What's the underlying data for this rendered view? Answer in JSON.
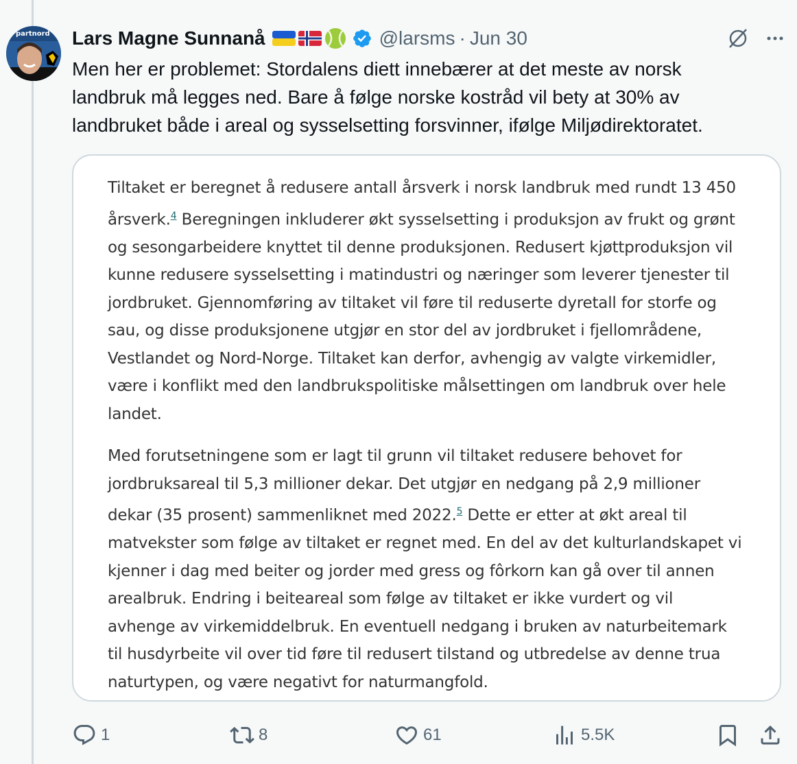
{
  "tweet": {
    "author_name": "Lars Magne Sunnanå",
    "handle": "@larsms",
    "separator": "·",
    "date": "Jun 30",
    "avatar_text": "partnord",
    "text_lines": [
      "Men her er problemet: Stordalens diett innebærer at det meste av norsk",
      "landbruk må legges ned. Bare å følge norske kostråd vil bety at 30% av",
      "landbruket både i areal og sysselsetting forsvinner, ifølge Miljødirektoratet."
    ]
  },
  "image": {
    "paragraph1": {
      "line1": "Tiltaket er beregnet å redusere antall årsverk i norsk landbruk med rundt 13 450",
      "line2_pre": "årsverk.",
      "line2_fn": "4",
      "line2_post": " Beregningen inkluderer økt sysselsetting i produksjon av frukt og grønt",
      "lines": [
        "og sesongarbeidere knyttet til denne produksjonen. Redusert kjøttproduksjon vil",
        "kunne redusere sysselsetting i matindustri og næringer som leverer tjenester til",
        "jordbruket. Gjennomføring av tiltaket vil føre til reduserte dyretall for storfe og",
        "sau, og disse produksjonene utgjør en stor del av jordbruket i fjellområdene,",
        "Vestlandet og Nord-Norge. Tiltaket kan derfor, avhengig av valgte virkemidler,",
        "være i konflikt med den landbrukspolitiske målsettingen om landbruk over hele",
        "landet."
      ]
    },
    "paragraph2": {
      "line1": "Med forutsetningene som er lagt til grunn vil tiltaket redusere behovet for",
      "line2": "jordbruksareal til 5,3 millioner dekar. Det utgjør en nedgang på 2,9 millioner",
      "line3_pre": "dekar (35 prosent) sammenliknet med 2022.",
      "line3_fn": "5",
      "line3_post": "  Dette er etter at økt areal til",
      "lines": [
        "matvekster som følge av tiltaket er regnet med. En del av det kulturlandskapet vi",
        "kjenner i dag med beiter og jorder med gress og fôrkorn kan gå over til annen",
        "arealbruk. Endring i beiteareal som følge av tiltaket er ikke vurdert og vil",
        "avhenge av virkemiddelbruk. En eventuell nedgang i bruken av naturbeitemark",
        "til husdyrbeite vil over tid føre til redusert tilstand og utbredelse av denne trua",
        "naturtypen, og være negativt for naturmangfold."
      ]
    }
  },
  "actions": {
    "replies": "1",
    "reposts": "8",
    "likes": "61",
    "views": "5.5K"
  },
  "icons": {
    "reply": "reply-icon",
    "repost": "repost-icon",
    "like": "heart-icon",
    "views": "views-icon",
    "bookmark": "bookmark-icon",
    "share": "share-icon",
    "grok": "grok-icon",
    "more": "more-icon",
    "verified": "verified-badge-icon"
  },
  "colors": {
    "verified": "#1d9bf0",
    "secondary_text": "#536471",
    "footnote_link": "#1f6a73"
  }
}
